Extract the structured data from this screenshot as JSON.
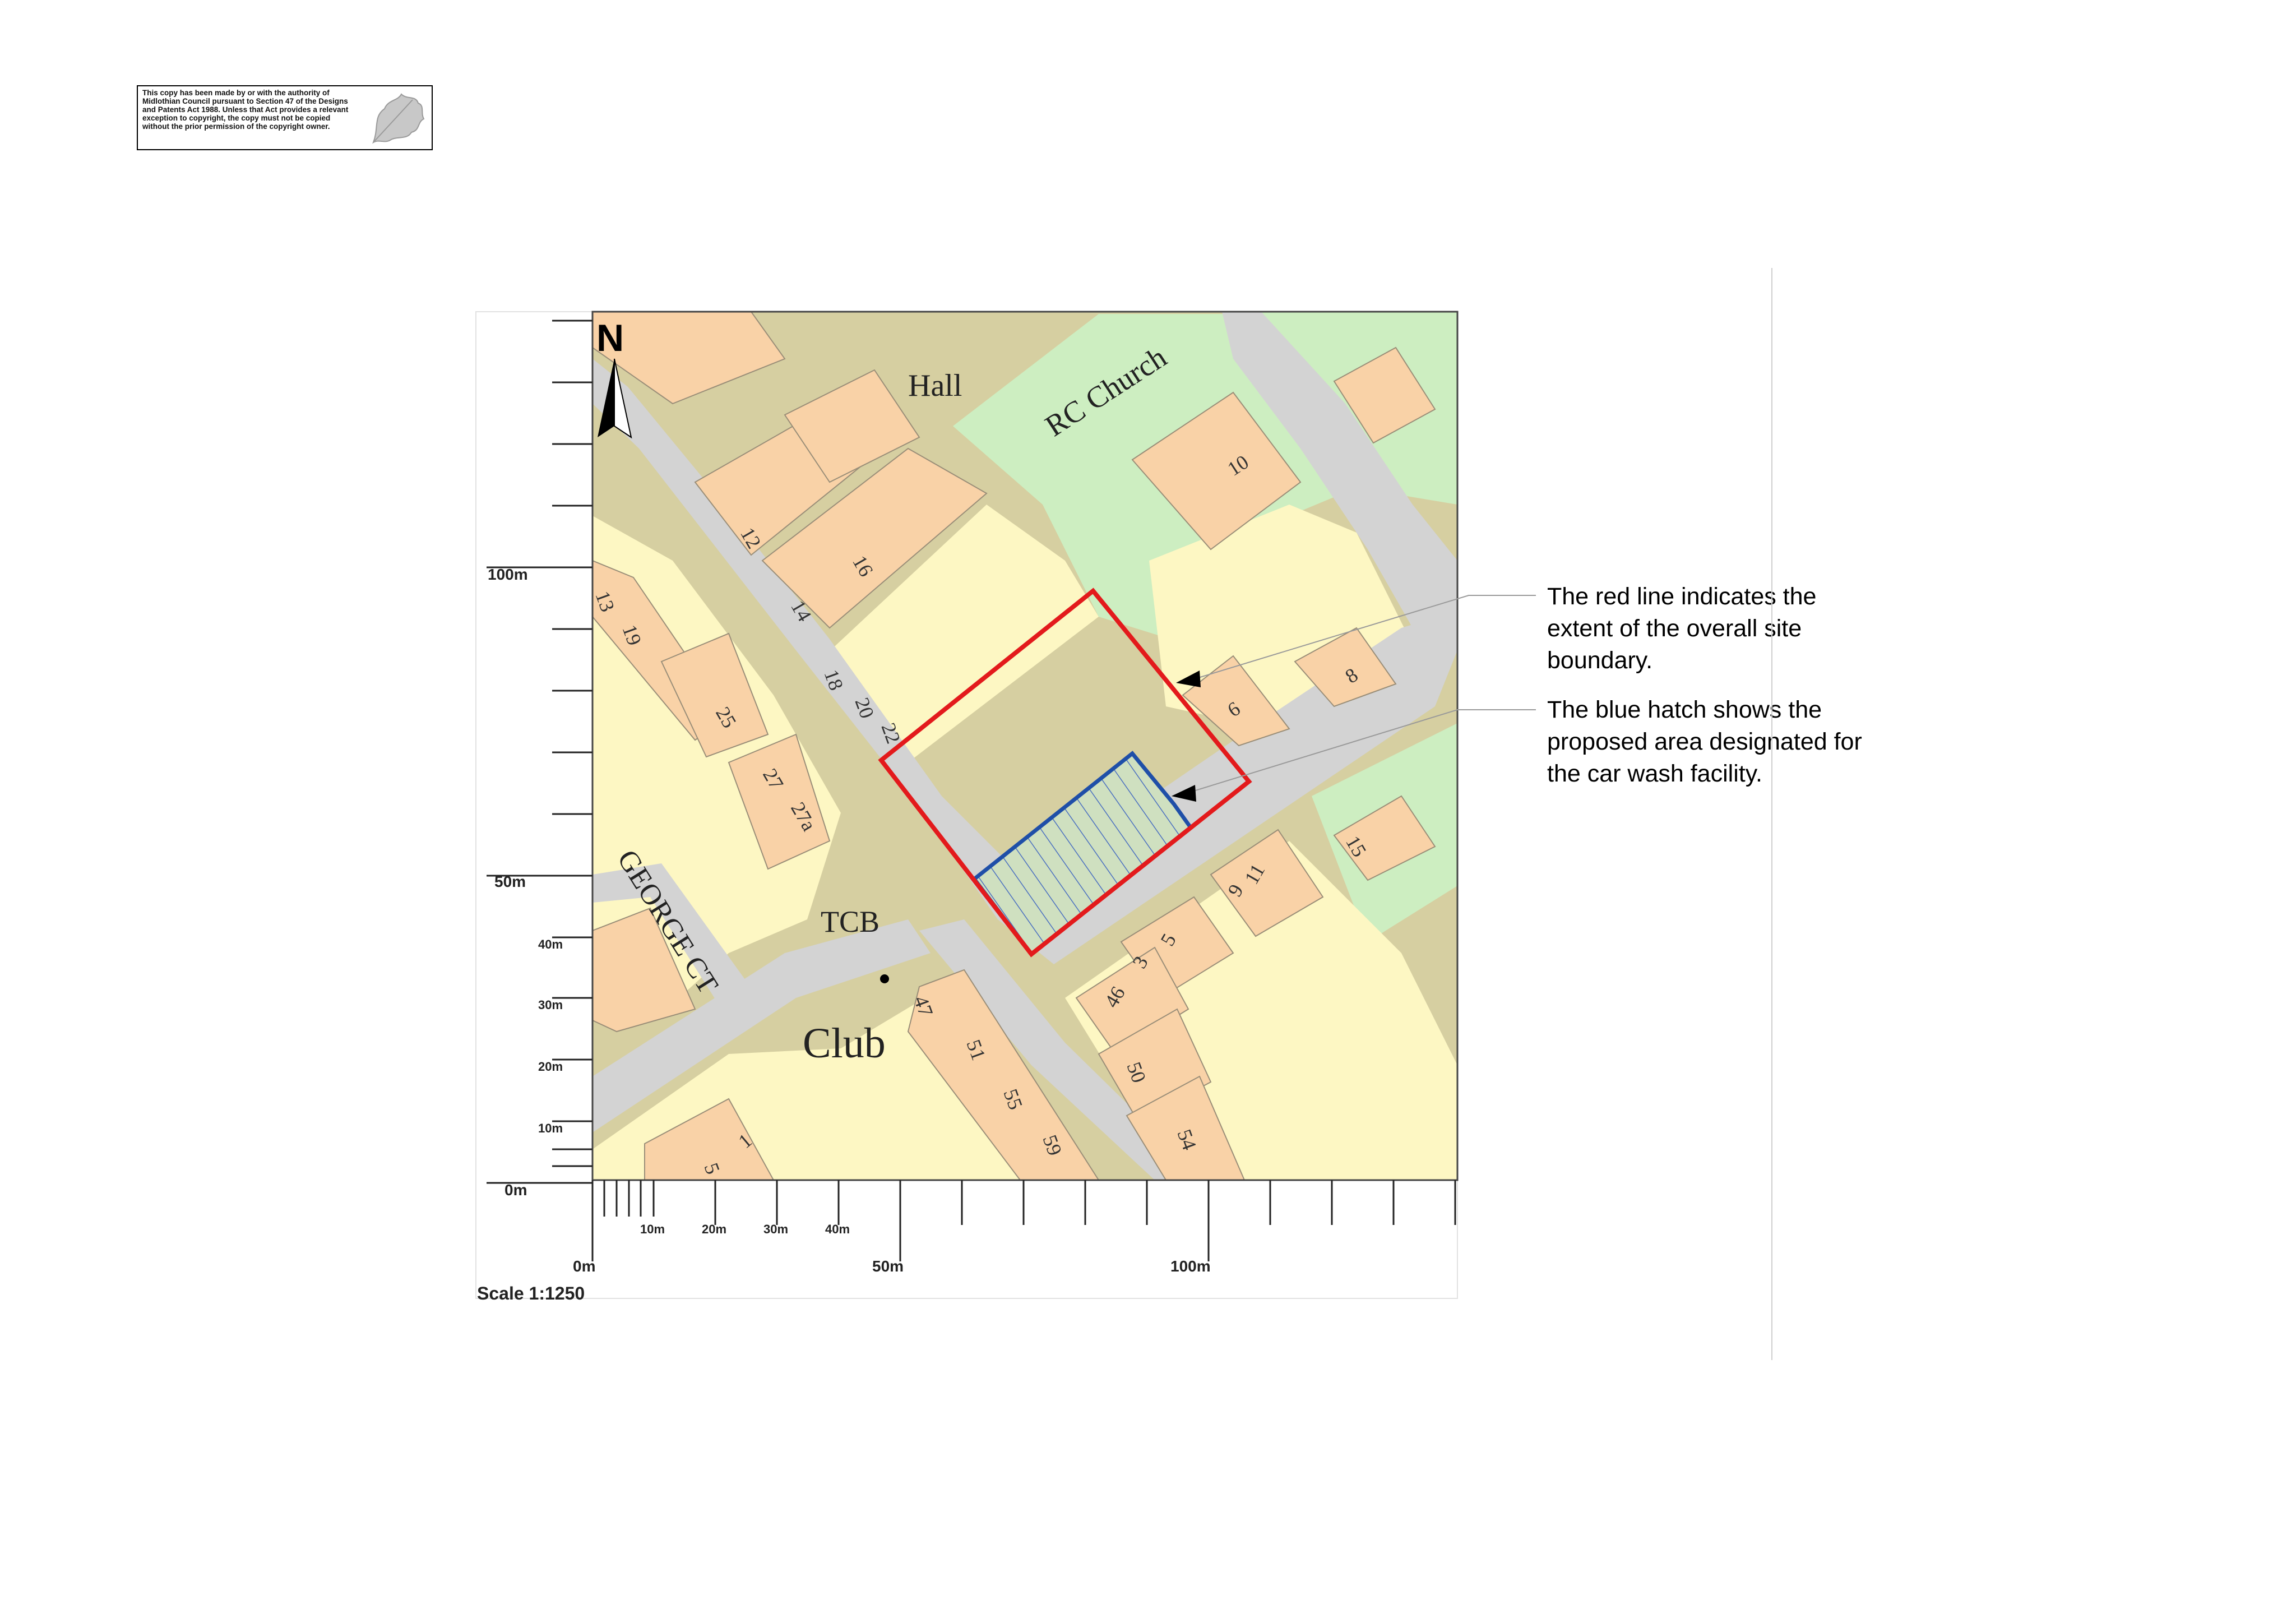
{
  "copyright_notice": "This copy has been made by or with the authority of Midlothian Council pursuant to Section 47 of the Designs and Patents Act 1988. Unless that Act provides a relevant exception to copyright, the copy must not be copied without the prior permission of the copyright owner.",
  "north_label": "N",
  "map_labels": {
    "hall": "Hall",
    "rc_church": "RC Church",
    "tcb": "TCB",
    "club": "Club",
    "george_ct": "GEORGE CT"
  },
  "house_numbers": [
    "12",
    "14",
    "16",
    "18",
    "20",
    "22",
    "13",
    "19",
    "25",
    "27",
    "27a",
    "10",
    "6",
    "8",
    "15",
    "11",
    "9",
    "5",
    "3",
    "46",
    "50",
    "54",
    "47",
    "51",
    "55",
    "59",
    "1",
    "5"
  ],
  "scale": {
    "label": "Scale 1:1250",
    "left_axis": [
      "100m",
      "50m",
      "40m",
      "30m",
      "20m",
      "10m",
      "0m"
    ],
    "bottom_axis_small": [
      "10m",
      "20m",
      "30m",
      "40m"
    ],
    "bottom_axis_major": [
      "0m",
      "50m",
      "100m"
    ]
  },
  "annotations": {
    "red_line": "The red line indicates the extent of the overall site boundary.",
    "blue_hatch": "The blue hatch shows the proposed area designated for the car wash facility."
  },
  "colors": {
    "site_boundary": "#e31a1c",
    "car_wash_area": "#1f4fa8",
    "building": "#f9d2a7",
    "yard": "#fdf7c3",
    "green_space": "#cdeec1",
    "road": "#d3d3d3",
    "ground": "#d6cfa1"
  }
}
